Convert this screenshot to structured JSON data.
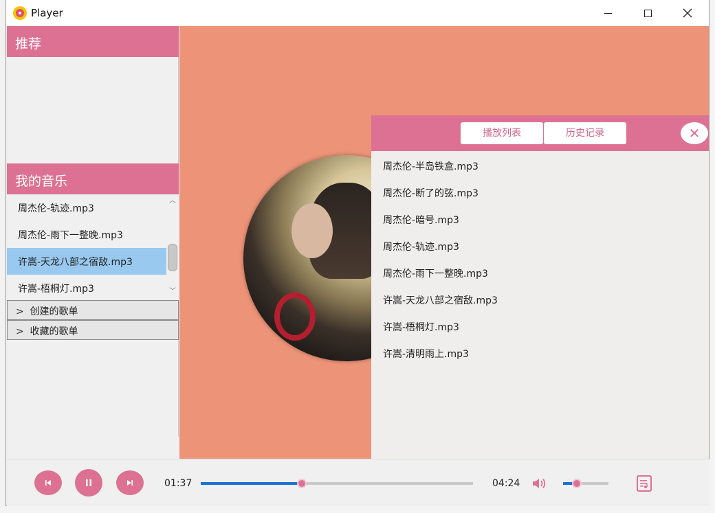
{
  "window": {
    "title": "Player"
  },
  "sidebar": {
    "recommend_title": "推荐",
    "my_music_title": "我的音乐",
    "songs": [
      {
        "label": "周杰伦-轨迹.mp3",
        "selected": false
      },
      {
        "label": "周杰伦-雨下一整晚.mp3",
        "selected": false
      },
      {
        "label": "许嵩-天龙八部之宿敌.mp3",
        "selected": true
      },
      {
        "label": "许嵩-梧桐灯.mp3",
        "selected": false
      }
    ],
    "tree": [
      {
        "chevron": ">",
        "label": "创建的歌单"
      },
      {
        "chevron": ">",
        "label": "收藏的歌单"
      }
    ]
  },
  "playlist": {
    "tab_playlist": "播放列表",
    "tab_history": "历史记录",
    "close_symbol": "✕",
    "songs": [
      "周杰伦-半岛铁盒.mp3",
      "周杰伦-断了的弦.mp3",
      "周杰伦-暗号.mp3",
      "周杰伦-轨迹.mp3",
      "周杰伦-雨下一整晚.mp3",
      "许嵩-天龙八部之宿敌.mp3",
      "许嵩-梧桐灯.mp3",
      "许嵩-清明雨上.mp3"
    ]
  },
  "controls": {
    "current_time": "01:37",
    "total_time": "04:24",
    "progress": 0.37,
    "volume": 0.3
  },
  "colors": {
    "accent": "#dc7194",
    "main_bg": "#ec9378",
    "selection": "#99c9ef",
    "progress_fill": "#1a73d4"
  },
  "icons": {
    "prev": "skip-previous-icon",
    "pause": "pause-icon",
    "next": "skip-next-icon",
    "volume": "volume-icon",
    "playlist": "playlist-icon"
  }
}
